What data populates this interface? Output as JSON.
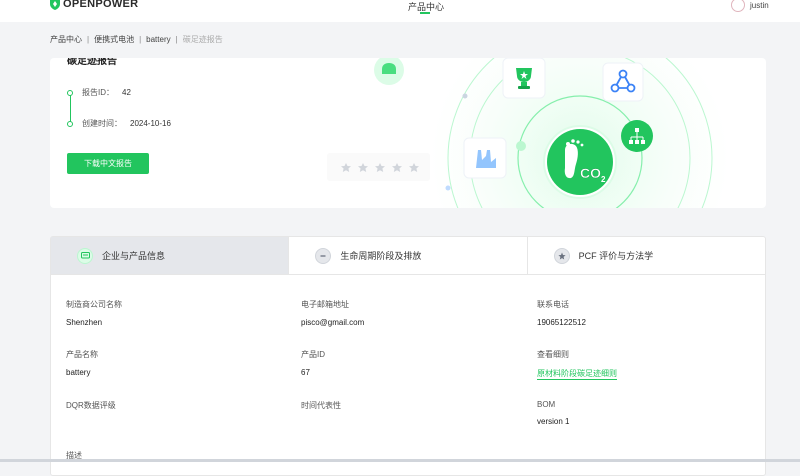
{
  "header": {
    "logo_text": "OPENPOWER",
    "nav_center": "产品中心",
    "user_name": "justin"
  },
  "breadcrumb": {
    "items": [
      "产品中心",
      "便携式电池",
      "battery"
    ],
    "current": "碳足迹报告"
  },
  "hero": {
    "title_partial": "碳足迹报告",
    "report_id_label": "报告ID：",
    "report_id": "42",
    "created_label": "创建时间：",
    "created": "2024-10-16",
    "download_label": "下载中文报告"
  },
  "tabs": [
    {
      "label": "企业与产品信息",
      "icon": "message-icon",
      "active": true
    },
    {
      "label": "生命周期阶段及排放",
      "icon": "minus-circle-icon",
      "active": false
    },
    {
      "label": "PCF 评价与方法学",
      "icon": "star-icon",
      "active": false
    }
  ],
  "info": {
    "company_label": "制造商公司名称",
    "company": "Shenzhen",
    "email_label": "电子邮箱地址",
    "email": "pisco@gmail.com",
    "phone_label": "联系电话",
    "phone": "19065122512",
    "product_name_label": "产品名称",
    "product_name": "battery",
    "product_id_label": "产品ID",
    "product_id": "67",
    "detail_label": "查看细则",
    "detail_link": "原材料阶段碳足迹细则",
    "dqr_label": "DQR数据评级",
    "time_label": "时间代表性",
    "bom_label": "BOM",
    "bom": "version 1",
    "desc_label": "描述"
  },
  "colors": {
    "accent": "#22c55e",
    "icon_blue": "#3b82f6"
  },
  "hero_icons": [
    "android-icon",
    "trophy-icon",
    "network-icon",
    "factory-icon",
    "hierarchy-icon",
    "co2-footprint-icon",
    "rating-stars-icon"
  ]
}
